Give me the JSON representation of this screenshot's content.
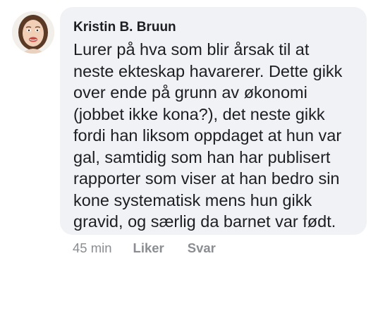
{
  "comment": {
    "author": "Kristin B. Bruun",
    "lines": [
      "Lurer på hva som blir årsak til at",
      "neste ekteskap havarerer. Dette gikk",
      "over ende på grunn av økonomi",
      "(jobbet ikke kona?), det neste gikk",
      "fordi han liksom oppdaget at hun var",
      "gal, samtidig som han har publisert",
      "rapporter som viser at han bedro sin",
      "kone systematisk mens hun gikk",
      "gravid, og særlig da barnet var født."
    ],
    "timestamp": "45 min",
    "like_label": "Liker",
    "reply_label": "Svar"
  },
  "colors": {
    "bubble": "#f0f2f5",
    "text": "#1c1e21",
    "meta": "#8a8d91"
  }
}
